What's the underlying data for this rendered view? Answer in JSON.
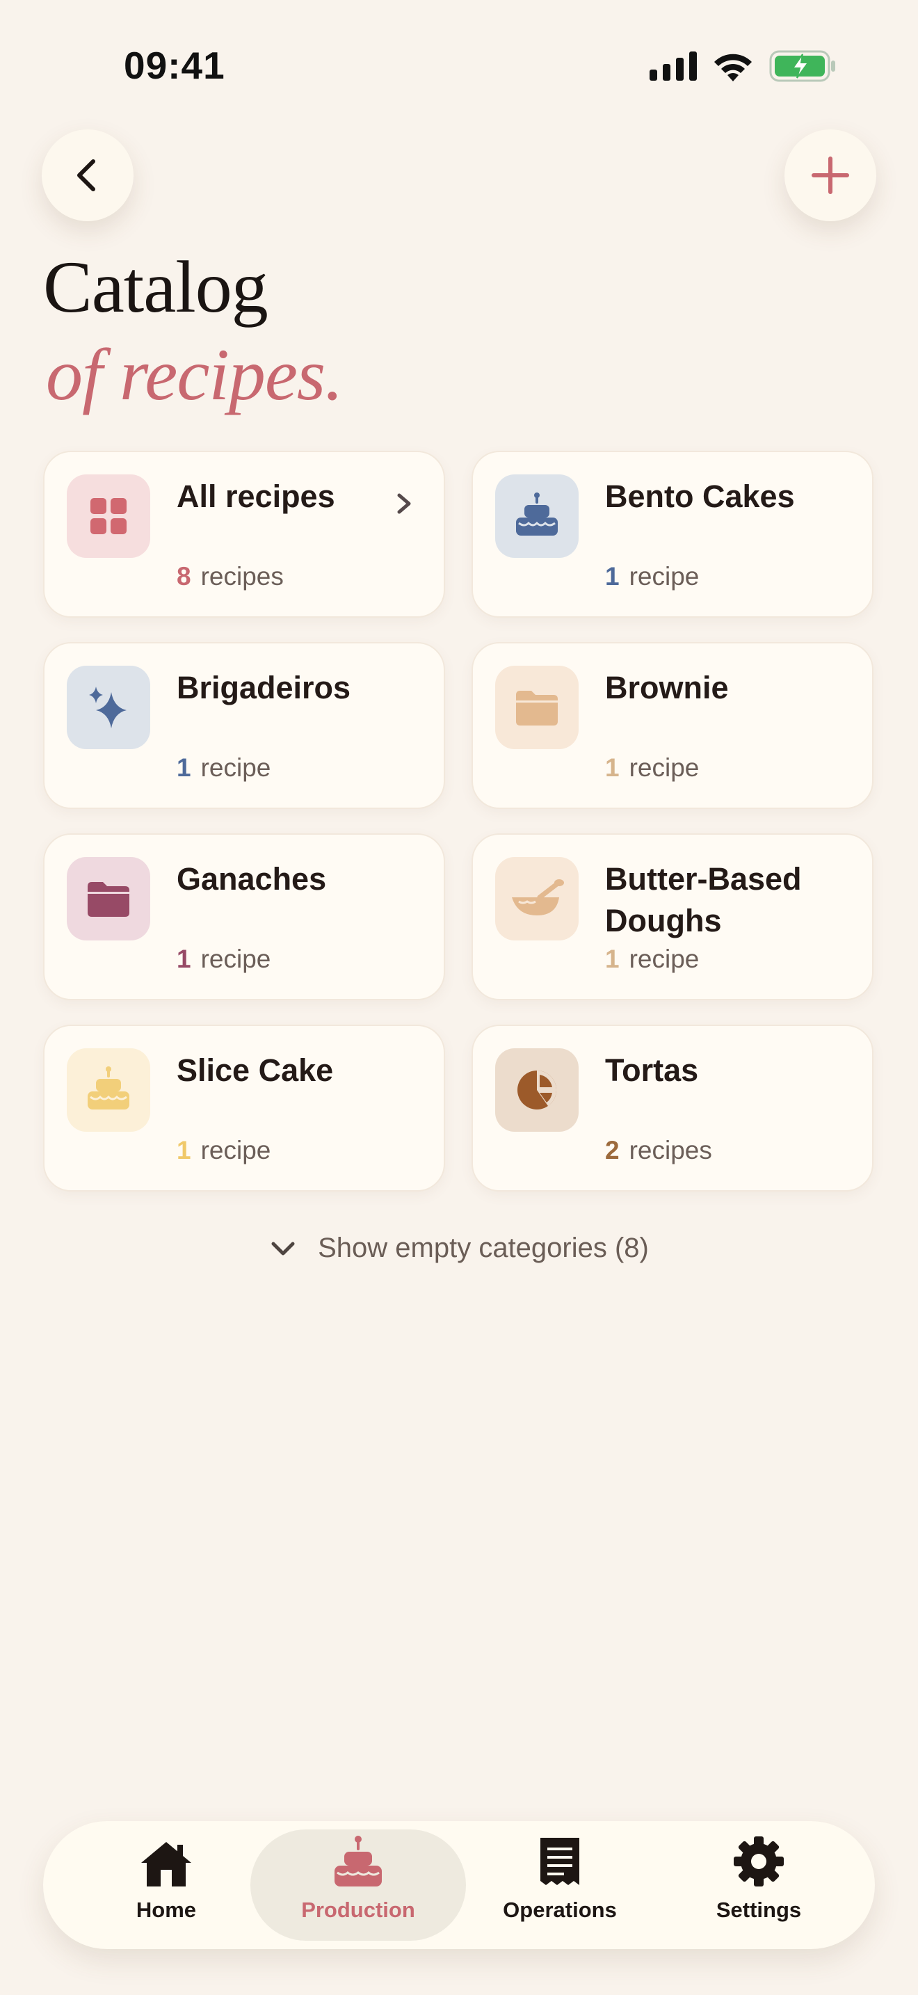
{
  "status_bar": {
    "time": "09:41"
  },
  "header": {
    "title": "Catalog",
    "subtitle": "of recipes."
  },
  "categories": [
    {
      "name": "All recipes",
      "count": "8",
      "unit": "recipes",
      "icon": "grid-icon",
      "count_color": "#c86870",
      "icon_bg": "#f6dede",
      "icon_color": "#d16870"
    },
    {
      "name": "Bento Cakes",
      "count": "1",
      "unit": "recipe",
      "icon": "cake-icon",
      "count_color": "#4e6a9a",
      "icon_bg": "#dde3ea",
      "icon_color": "#4e6a9a"
    },
    {
      "name": "Brigadeiros",
      "count": "1",
      "unit": "recipe",
      "icon": "sparkle-icon",
      "count_color": "#4e6a9a",
      "icon_bg": "#dde3ea",
      "icon_color": "#4e6a9a"
    },
    {
      "name": "Brownie",
      "count": "1",
      "unit": "recipe",
      "icon": "folder-icon",
      "count_color": "#d6b48c",
      "icon_bg": "#f8e8d8",
      "icon_color": "#e3b98f"
    },
    {
      "name": "Ganaches",
      "count": "1",
      "unit": "recipe",
      "icon": "folder-icon",
      "count_color": "#974a66",
      "icon_bg": "#efd9df",
      "icon_color": "#974a66"
    },
    {
      "name": "Butter-Based Doughs",
      "count": "1",
      "unit": "recipe",
      "icon": "bowl-icon",
      "count_color": "#d6b48c",
      "icon_bg": "#f8e8d8",
      "icon_color": "#e3b98f"
    },
    {
      "name": "Slice Cake",
      "count": "1",
      "unit": "recipe",
      "icon": "cake-icon",
      "count_color": "#f0c96a",
      "icon_bg": "#fcf0d8",
      "icon_color": "#f2cf7a"
    },
    {
      "name": "Tortas",
      "count": "2",
      "unit": "recipes",
      "icon": "pie-chart-icon",
      "count_color": "#9c6a3c",
      "icon_bg": "#ecdccc",
      "icon_color": "#9c5a2a"
    }
  ],
  "show_empty": {
    "label": "Show empty categories (8)"
  },
  "tabbar": {
    "items": [
      {
        "label": "Home",
        "icon": "home-icon"
      },
      {
        "label": "Production",
        "icon": "cake-icon",
        "active": true
      },
      {
        "label": "Operations",
        "icon": "receipt-icon"
      },
      {
        "label": "Settings",
        "icon": "gear-icon"
      }
    ]
  },
  "colors": {
    "accent": "#c86870",
    "background": "#f9f3ec",
    "card": "#fffbf4"
  }
}
